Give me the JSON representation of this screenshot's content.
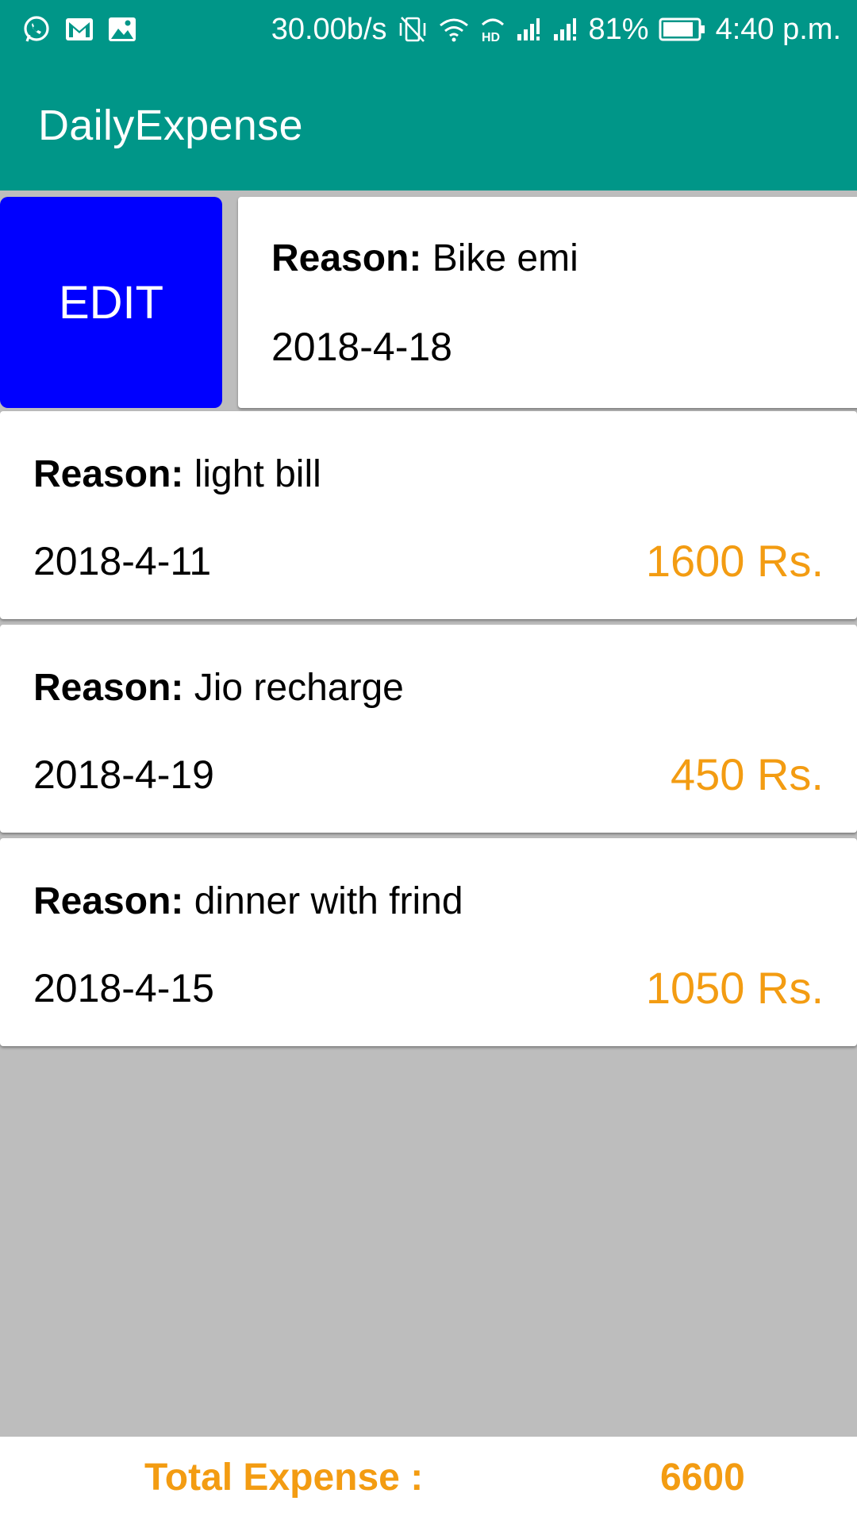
{
  "status_bar": {
    "left_icons": [
      "whatsapp-icon",
      "gmail-icon",
      "gallery-icon"
    ],
    "speed": "30.00b/s",
    "battery": "81%",
    "time": "4:40 p.m."
  },
  "app_bar": {
    "title": "DailyExpense"
  },
  "colors": {
    "primary": "#009688",
    "edit_button": "#0000ff",
    "amount": "#f39c12",
    "background": "#bdbdbd"
  },
  "expenses": [
    {
      "reason_label": "Reason:",
      "reason": "Bike emi",
      "date": "2018-4-18",
      "edit_label": "EDIT"
    },
    {
      "reason_label": "Reason:",
      "reason": "light bill",
      "date": "2018-4-11",
      "amount": "1600 Rs."
    },
    {
      "reason_label": "Reason:",
      "reason": "Jio recharge",
      "date": "2018-4-19",
      "amount": "450 Rs."
    },
    {
      "reason_label": "Reason:",
      "reason": "dinner with frind",
      "date": "2018-4-15",
      "amount": "1050 Rs."
    }
  ],
  "footer": {
    "total_label": "Total Expense :",
    "total_value": "6600"
  }
}
